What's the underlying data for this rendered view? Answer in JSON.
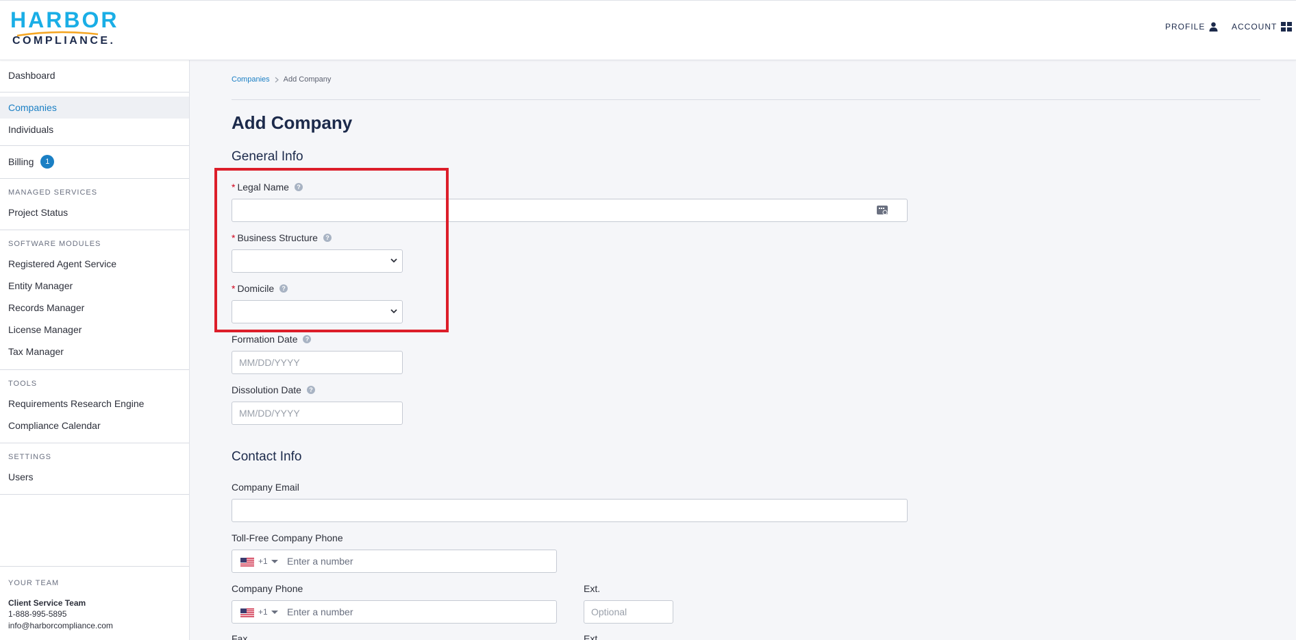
{
  "brand": {
    "line1": "HARBOR",
    "line2": "COMPLIANCE.",
    "primary_color": "#1aaee6",
    "navy": "#1c2a4b",
    "swoosh_color": "#f5a623"
  },
  "header": {
    "profile_label": "PROFILE",
    "profile_icon": "user-icon",
    "account_label": "ACCOUNT",
    "account_icon": "grid-icon"
  },
  "sidebar": {
    "dashboard": "Dashboard",
    "companies": "Companies",
    "individuals": "Individuals",
    "billing": "Billing",
    "billing_badge": "1",
    "managed_services_heading": "MANAGED SERVICES",
    "project_status": "Project Status",
    "software_modules_heading": "SOFTWARE MODULES",
    "registered_agent": "Registered Agent Service",
    "entity_manager": "Entity Manager",
    "records_manager": "Records Manager",
    "license_manager": "License Manager",
    "tax_manager": "Tax Manager",
    "tools_heading": "TOOLS",
    "requirements_engine": "Requirements Research Engine",
    "compliance_calendar": "Compliance Calendar",
    "settings_heading": "SETTINGS",
    "users": "Users",
    "team_heading": "YOUR TEAM",
    "team_name": "Client Service Team",
    "team_phone": "1-888-995-5895",
    "team_email": "info@harborcompliance.com"
  },
  "breadcrumb": {
    "root": "Companies",
    "current": "Add Company"
  },
  "page": {
    "title": "Add Company"
  },
  "general_info": {
    "heading": "General Info",
    "legal_name_label": "Legal Name",
    "business_structure_label": "Business Structure",
    "domicile_label": "Domicile",
    "formation_date_label": "Formation Date",
    "formation_date_placeholder": "MM/DD/YYYY",
    "dissolution_date_label": "Dissolution Date",
    "dissolution_date_placeholder": "MM/DD/YYYY"
  },
  "contact_info": {
    "heading": "Contact Info",
    "company_email_label": "Company Email",
    "toll_free_label": "Toll-Free Company Phone",
    "company_phone_label": "Company Phone",
    "country_code": "+1",
    "phone_placeholder": "Enter a number",
    "ext_label": "Ext.",
    "ext_placeholder": "Optional",
    "fax_label": "Fax",
    "fax_ext_label": "Ext."
  },
  "colors": {
    "link": "#1a7fc4",
    "required": "#d0021b",
    "highlight": "#dc1e2a"
  }
}
